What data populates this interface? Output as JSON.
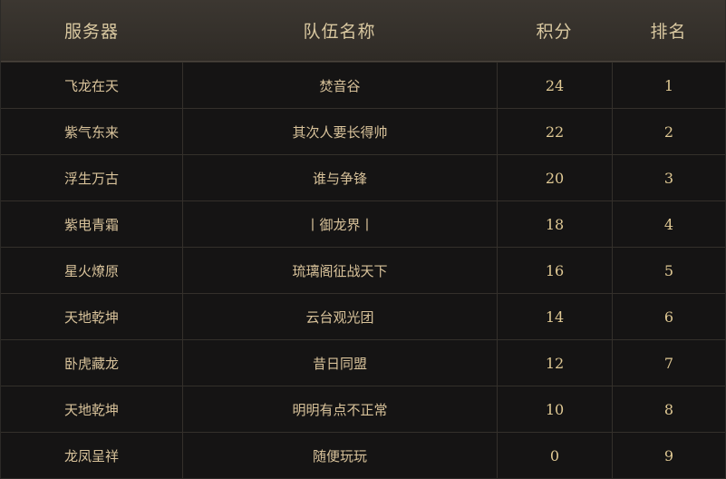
{
  "table": {
    "headers": {
      "server": "服务器",
      "team_name": "队伍名称",
      "score": "积分",
      "rank": "排名"
    },
    "rows": [
      {
        "server": "飞龙在天",
        "team_name": "焚音谷",
        "score": "24",
        "rank": "1"
      },
      {
        "server": "紫气东来",
        "team_name": "其次人要长得帅",
        "score": "22",
        "rank": "2"
      },
      {
        "server": "浮生万古",
        "team_name": "谁与争锋",
        "score": "20",
        "rank": "3"
      },
      {
        "server": "紫电青霜",
        "team_name": "丨御龙界丨",
        "score": "18",
        "rank": "4"
      },
      {
        "server": "星火燎原",
        "team_name": "琉璃阁征战天下",
        "score": "16",
        "rank": "5"
      },
      {
        "server": "天地乾坤",
        "team_name": "云台观光团",
        "score": "14",
        "rank": "6"
      },
      {
        "server": "卧虎藏龙",
        "team_name": "昔日同盟",
        "score": "12",
        "rank": "7"
      },
      {
        "server": "天地乾坤",
        "team_name": "明明有点不正常",
        "score": "10",
        "rank": "8"
      },
      {
        "server": "龙凤呈祥",
        "team_name": "随便玩玩",
        "score": "0",
        "rank": "9"
      }
    ]
  },
  "colors": {
    "background": "#151414",
    "header_background": "#3c3731",
    "header_text": "#d9c8a0",
    "cell_text": "#d8c29a",
    "grid_line": "#34302b"
  }
}
